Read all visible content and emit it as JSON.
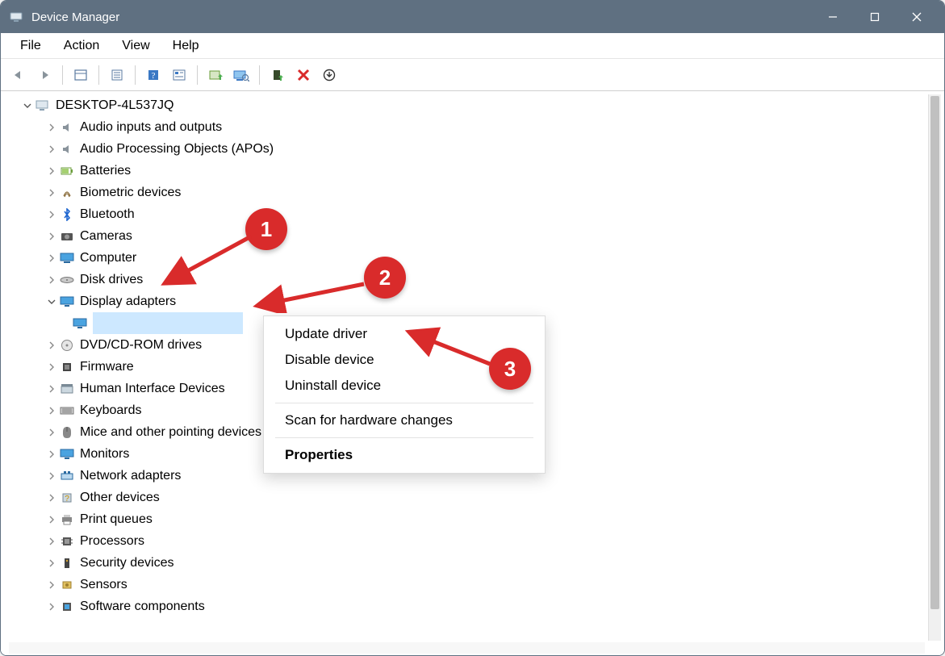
{
  "window": {
    "title": "Device Manager"
  },
  "menubar": [
    "File",
    "Action",
    "View",
    "Help"
  ],
  "toolbar_icons": [
    "back-icon",
    "forward-icon",
    "sep",
    "show-hidden-icon",
    "sep",
    "properties-icon",
    "sep",
    "help-icon",
    "details-icon",
    "sep",
    "update-driver-icon",
    "scan-hardware-icon",
    "sep",
    "enable-icon",
    "disable-icon",
    "uninstall-icon"
  ],
  "tree": {
    "root": {
      "label": "DESKTOP-4L537JQ",
      "expanded": true
    },
    "categories": [
      {
        "label": "Audio inputs and outputs",
        "icon": "speaker-icon",
        "expanded": false
      },
      {
        "label": "Audio Processing Objects (APOs)",
        "icon": "speaker-icon",
        "expanded": false
      },
      {
        "label": "Batteries",
        "icon": "battery-icon",
        "expanded": false
      },
      {
        "label": "Biometric devices",
        "icon": "fingerprint-icon",
        "expanded": false
      },
      {
        "label": "Bluetooth",
        "icon": "bluetooth-icon",
        "expanded": false
      },
      {
        "label": "Cameras",
        "icon": "camera-icon",
        "expanded": false
      },
      {
        "label": "Computer",
        "icon": "computer-icon",
        "expanded": false
      },
      {
        "label": "Disk drives",
        "icon": "disk-icon",
        "expanded": false
      },
      {
        "label": "Display adapters",
        "icon": "display-icon",
        "expanded": true,
        "children": [
          {
            "label": "",
            "icon": "display-icon",
            "selected": true
          }
        ]
      },
      {
        "label": "DVD/CD-ROM drives",
        "icon": "optical-icon",
        "expanded": false
      },
      {
        "label": "Firmware",
        "icon": "firmware-icon",
        "expanded": false
      },
      {
        "label": "Human Interface Devices",
        "icon": "hid-icon",
        "expanded": false
      },
      {
        "label": "Keyboards",
        "icon": "keyboard-icon",
        "expanded": false
      },
      {
        "label": "Mice and other pointing devices",
        "icon": "mouse-icon",
        "expanded": false
      },
      {
        "label": "Monitors",
        "icon": "monitor-icon",
        "expanded": false
      },
      {
        "label": "Network adapters",
        "icon": "network-icon",
        "expanded": false
      },
      {
        "label": "Other devices",
        "icon": "other-icon",
        "expanded": false
      },
      {
        "label": "Print queues",
        "icon": "printer-icon",
        "expanded": false
      },
      {
        "label": "Processors",
        "icon": "cpu-icon",
        "expanded": false
      },
      {
        "label": "Security devices",
        "icon": "security-icon",
        "expanded": false
      },
      {
        "label": "Sensors",
        "icon": "sensor-icon",
        "expanded": false
      },
      {
        "label": "Software components",
        "icon": "software-icon",
        "expanded": false
      }
    ]
  },
  "context_menu": {
    "items": [
      {
        "label": "Update driver",
        "type": "item"
      },
      {
        "label": "Disable device",
        "type": "item"
      },
      {
        "label": "Uninstall device",
        "type": "item"
      },
      {
        "type": "sep"
      },
      {
        "label": "Scan for hardware changes",
        "type": "item"
      },
      {
        "type": "sep"
      },
      {
        "label": "Properties",
        "type": "item",
        "bold": true
      }
    ]
  },
  "annotations": {
    "n1": "1",
    "n2": "2",
    "n3": "3"
  }
}
